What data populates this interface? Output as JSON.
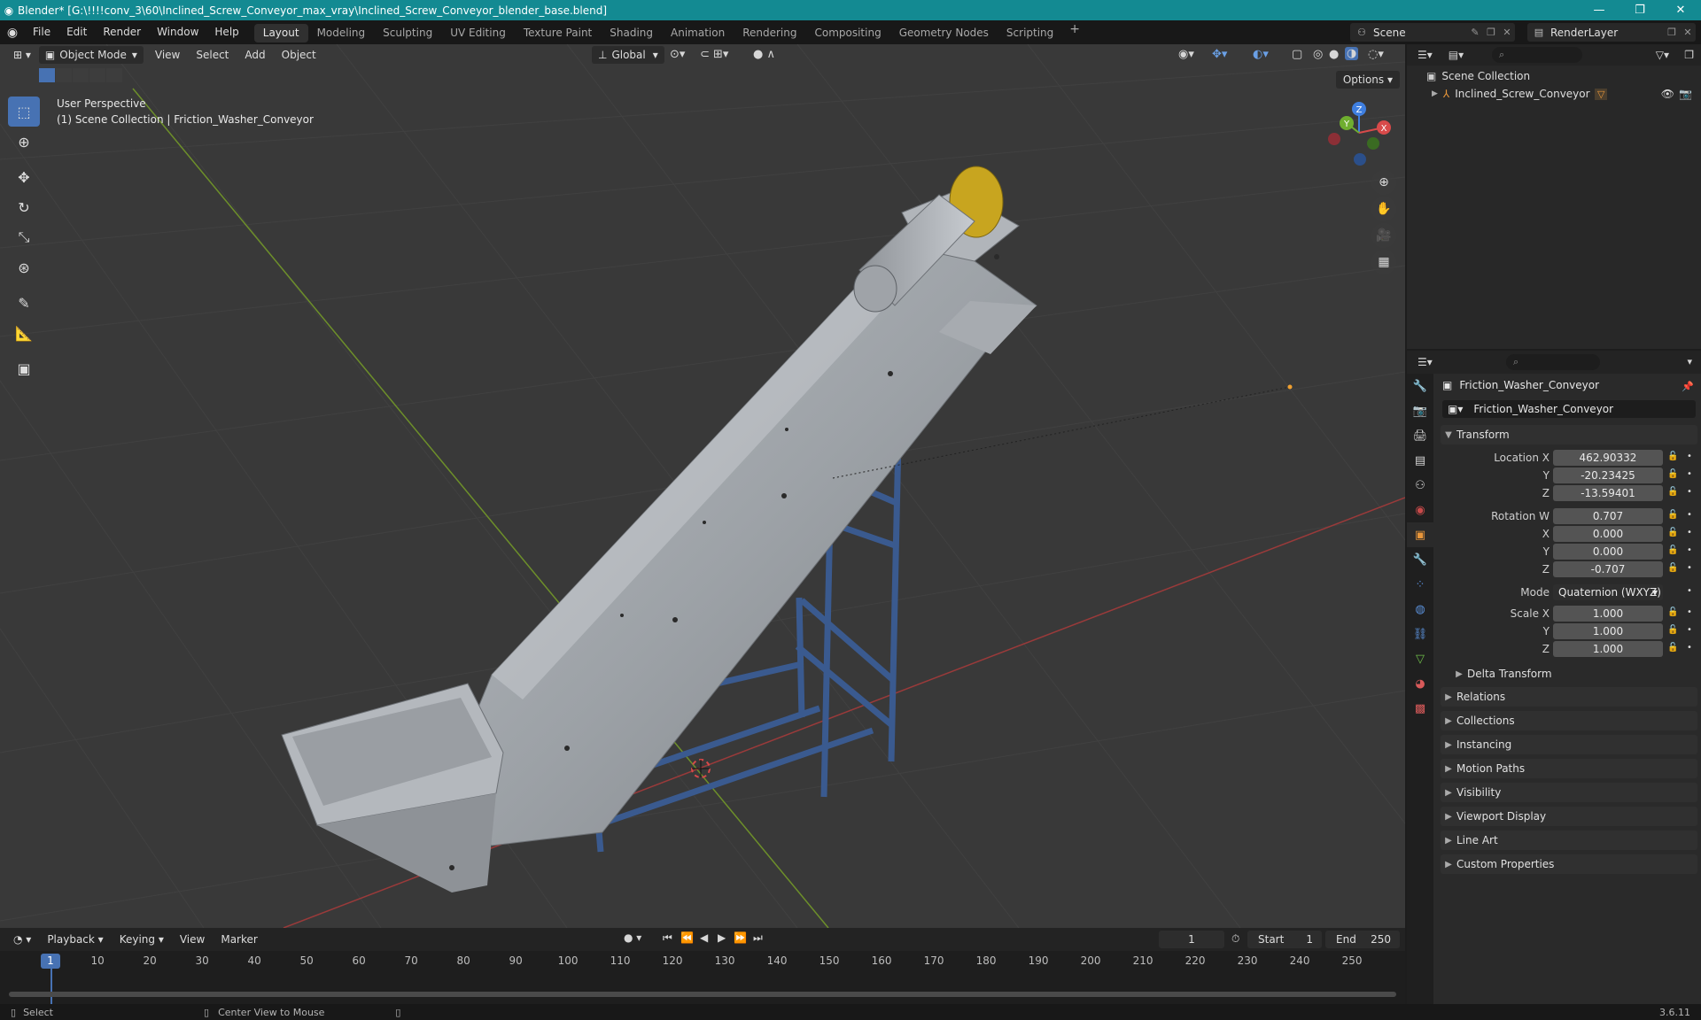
{
  "window": {
    "title": "Blender* [G:\\!!!!conv_3\\60\\Inclined_Screw_Conveyor_max_vray\\Inclined_Screw_Conveyor_blender_base.blend]"
  },
  "menu": {
    "file": "File",
    "edit": "Edit",
    "render": "Render",
    "window": "Window",
    "help": "Help"
  },
  "workspaces": [
    "Layout",
    "Modeling",
    "Sculpting",
    "UV Editing",
    "Texture Paint",
    "Shading",
    "Animation",
    "Rendering",
    "Compositing",
    "Geometry Nodes",
    "Scripting"
  ],
  "active_workspace": "Layout",
  "scene": "Scene",
  "render_layer": "RenderLayer",
  "viewport": {
    "mode": "Object Mode",
    "menus": {
      "view": "View",
      "select": "Select",
      "add": "Add",
      "object": "Object"
    },
    "orientation": "Global",
    "options": "Options",
    "perspective_label": "User Perspective",
    "collection_label": "(1) Scene Collection | Friction_Washer_Conveyor",
    "gizmo_axes": {
      "x": "X",
      "y": "Y",
      "z": "Z"
    }
  },
  "timeline": {
    "menus": {
      "playback": "Playback",
      "keying": "Keying",
      "view": "View",
      "marker": "Marker"
    },
    "current_frame": "1",
    "start_label": "Start",
    "start": "1",
    "end_label": "End",
    "end": "250",
    "ruler": [
      "1",
      "10",
      "20",
      "30",
      "40",
      "50",
      "60",
      "70",
      "80",
      "90",
      "100",
      "110",
      "120",
      "130",
      "140",
      "150",
      "160",
      "170",
      "180",
      "190",
      "200",
      "210",
      "220",
      "230",
      "240",
      "250"
    ]
  },
  "status": {
    "select": "Select",
    "center_view": "Center View to Mouse",
    "version": "3.6.11"
  },
  "outliner": {
    "scene_collection": "Scene Collection",
    "item": "Inclined_Screw_Conveyor"
  },
  "properties": {
    "object_name": "Friction_Washer_Conveyor",
    "name_field": "Friction_Washer_Conveyor",
    "transform_title": "Transform",
    "location": {
      "label": "Location X",
      "x": "462.90332",
      "y": "-20.23425",
      "z": "-13.59401"
    },
    "rotation": {
      "label": "Rotation W",
      "w": "0.707",
      "x": "0.000",
      "y": "0.000",
      "z": "-0.707"
    },
    "mode_label": "Mode",
    "mode_value": "Quaternion (WXYZ)",
    "scale": {
      "label": "Scale X",
      "x": "1.000",
      "y": "1.000",
      "z": "1.000"
    },
    "axis_y": "Y",
    "axis_x": "X",
    "axis_z": "Z",
    "delta_transform": "Delta Transform",
    "panels": [
      "Relations",
      "Collections",
      "Instancing",
      "Motion Paths",
      "Visibility",
      "Viewport Display",
      "Line Art",
      "Custom Properties"
    ]
  }
}
